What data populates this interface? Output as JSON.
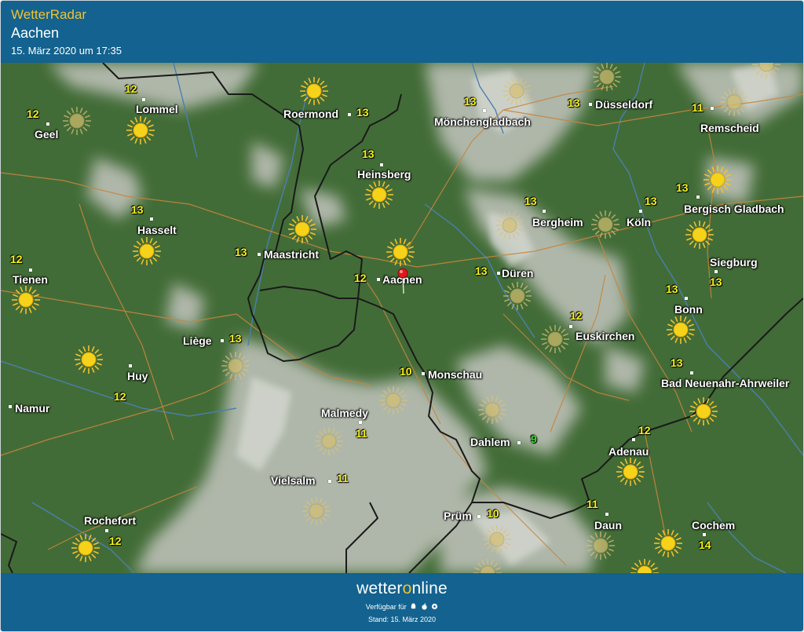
{
  "header": {
    "app_title": "WetterRadar",
    "location": "Aachen",
    "timestamp": "15. März 2020 um 17:35"
  },
  "map": {
    "cities": [
      {
        "name": "Geel",
        "temp": "12"
      },
      {
        "name": "Lommel",
        "temp": "12"
      },
      {
        "name": "Roermond",
        "temp": "13"
      },
      {
        "name": "Mönchengladbach",
        "temp": "13"
      },
      {
        "name": "Düsseldorf",
        "temp": "13"
      },
      {
        "name": "Remscheid",
        "temp": "11"
      },
      {
        "name": "Heinsberg",
        "temp": "13"
      },
      {
        "name": "Hasselt",
        "temp": "13"
      },
      {
        "name": "Bergheim",
        "temp": "13"
      },
      {
        "name": "Köln",
        "temp": "13"
      },
      {
        "name": "Bergisch Gladbach",
        "temp": "13"
      },
      {
        "name": "Maastricht",
        "temp": "13"
      },
      {
        "name": "Tienen",
        "temp": "12"
      },
      {
        "name": "Aachen",
        "temp": "12"
      },
      {
        "name": "Düren",
        "temp": "13"
      },
      {
        "name": "Siegburg",
        "temp": "13"
      },
      {
        "name": "Bonn",
        "temp": "13"
      },
      {
        "name": "Liège",
        "temp": "13"
      },
      {
        "name": "Euskirchen",
        "temp": "12"
      },
      {
        "name": "Huy",
        "temp": "12"
      },
      {
        "name": "Monschau",
        "temp": "10"
      },
      {
        "name": "Bad Neuenahr-Ahrweiler",
        "temp": "13"
      },
      {
        "name": "Namur",
        "temp": ""
      },
      {
        "name": "Malmedy",
        "temp": "11"
      },
      {
        "name": "Dahlem",
        "temp": "9"
      },
      {
        "name": "Adenau",
        "temp": "12"
      },
      {
        "name": "Vielsalm",
        "temp": "11"
      },
      {
        "name": "Prüm",
        "temp": "10"
      },
      {
        "name": "Daun",
        "temp": "11"
      },
      {
        "name": "Rochefort",
        "temp": "12"
      },
      {
        "name": "Cochem",
        "temp": "14"
      }
    ],
    "marker_icon": "location-pin-icon",
    "weather_icon": "sun-icon",
    "colors": {
      "land": "#426c37",
      "cloud": "#b9beb4",
      "temp_text": "#f5f21e",
      "temp_cold": "#34e12f",
      "border": "#1a1a1a",
      "road": "#c7853d",
      "river": "#4a7fb0",
      "sun": "#f2c230"
    }
  },
  "footer": {
    "brand_prefix": "wetter",
    "brand_o": "o",
    "brand_suffix": "nline",
    "available": "Verfügbar für",
    "platform_icons": [
      "android-icon",
      "apple-icon",
      "windows-icon"
    ],
    "stand": "Stand: 15. März 2020"
  }
}
